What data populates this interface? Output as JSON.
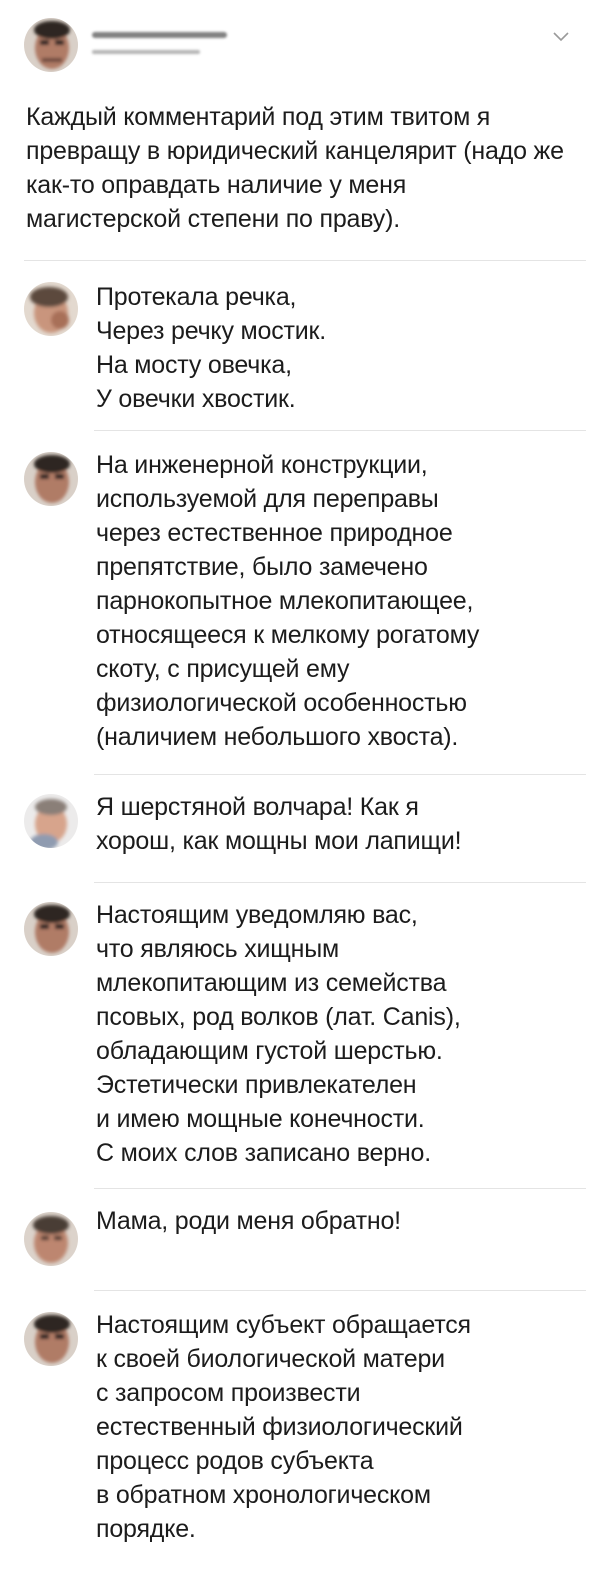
{
  "tweet": {
    "text": "Каждый комментарий под этим твитом я превращу в юридический канцелярит (надо же как-то оправдать наличие у меня магистерской степени по праву)."
  },
  "replies": [
    {
      "text": "Протекала речка,\nЧерез речку мостик.\nНа мосту овечка,\nУ овечки хвостик."
    },
    {
      "text": "На инженерной конструкции,\nиспользуемой для переправы\nчерез естественное природное\nпрепятствие, было замечено\nпарнокопытное млекопитающее,\nотносящееся к мелкому рогатому\nскоту, с присущей ему\nфизиологической особенностью\n(наличием небольшого хвоста)."
    },
    {
      "text": "Я шерстяной волчара! Как я\nхорош, как мощны мои лапищи!"
    },
    {
      "text": "Настоящим уведомляю вас,\nчто являюсь хищным\nмлекопитающим из семейства\nпсовых, род волков (лат. Canis),\nобладающим густой шерстью.\nЭстетически привлекателен\nи имею мощные конечности.\nС моих слов записано верно."
    },
    {
      "text": "Мама, роди меня обратно!"
    },
    {
      "text": "Настоящим субъект обращается\nк своей биологической матери\nс запросом произвести\nестественный физиологический\nпроцесс родов субъекта\nв обратном хронологическом\nпорядке."
    }
  ],
  "icons": {
    "menu": "chevron-down-icon"
  },
  "colors": {
    "text": "#1c1c1c",
    "divider": "#e4e4e4",
    "muted": "#9a9a9a"
  }
}
